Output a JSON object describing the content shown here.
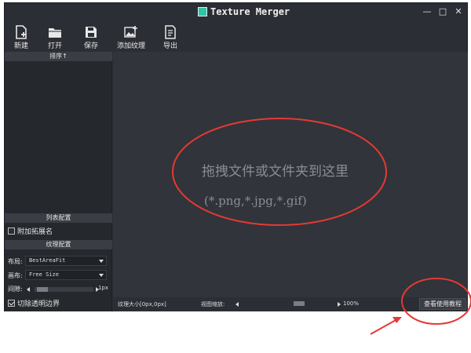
{
  "window": {
    "title": "Texture Merger",
    "controls": {
      "minimize": "—",
      "maximize": "□",
      "close": "✕"
    }
  },
  "toolbar": {
    "items": [
      {
        "label": "新建",
        "icon": "new-file-icon"
      },
      {
        "label": "打开",
        "icon": "folder-open-icon"
      },
      {
        "label": "保存",
        "icon": "save-icon"
      },
      {
        "label": "添加纹理",
        "icon": "add-image-icon"
      },
      {
        "label": "导出",
        "icon": "export-icon"
      }
    ]
  },
  "sidebar": {
    "sort_header": "排序↑",
    "list_config_header": "列表配置",
    "append_extension_label": "附加拓展名",
    "append_extension_checked": false,
    "texture_config_header": "纹理配置",
    "layout_label": "布局:",
    "layout_value": "BestAreaFit",
    "canvas_label": "画布:",
    "canvas_value": "Free Size",
    "spacing_label": "间隙:",
    "spacing_value": "1px",
    "trim_label": "切除透明边界",
    "trim_checked": true
  },
  "canvas": {
    "drop_hint": "拖拽文件或文件夹到这里",
    "drop_types": "(*.png,*.jpg,*.gif)"
  },
  "statusbar": {
    "texture_size": "纹理大小[0px,0px]",
    "zoom_label": "视图缩放:",
    "zoom_value": "100%",
    "tutorial_button": "查看使用教程"
  },
  "colors": {
    "window_bg": "#2b2e34",
    "canvas_bg": "#31343a",
    "annotation_red": "#e53935"
  }
}
